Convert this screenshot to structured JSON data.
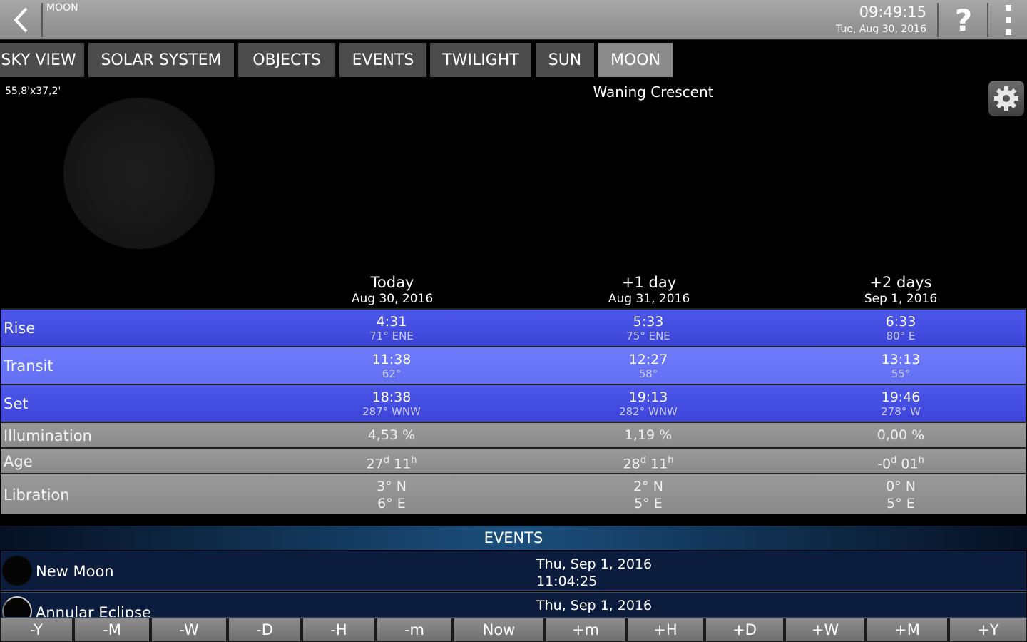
{
  "header": {
    "title": "MOON",
    "time": "09:49:15",
    "date": "Tue, Aug 30, 2016",
    "back_icon": "chevron-left-icon",
    "help_label": "?",
    "menu_icon": "overflow-menu-icon"
  },
  "tabs": [
    {
      "label": "SKY VIEW",
      "active": false
    },
    {
      "label": "SOLAR SYSTEM",
      "active": false
    },
    {
      "label": "OBJECTS",
      "active": false
    },
    {
      "label": "EVENTS",
      "active": false
    },
    {
      "label": "TWILIGHT",
      "active": false
    },
    {
      "label": "SUN",
      "active": false
    },
    {
      "label": "MOON",
      "active": true
    }
  ],
  "moon": {
    "angular_size": "55,8'x37,2'",
    "phase": "Waning Crescent",
    "settings_icon": "gear-icon"
  },
  "columns": [
    {
      "title": "Today",
      "date": "Aug 30, 2016"
    },
    {
      "title": "+1 day",
      "date": "Aug 31, 2016"
    },
    {
      "title": "+2 days",
      "date": "Sep 1, 2016"
    }
  ],
  "rows": {
    "rise": {
      "label": "Rise",
      "cells": [
        {
          "time": "4:31",
          "detail": "71° ENE"
        },
        {
          "time": "5:33",
          "detail": "75° ENE"
        },
        {
          "time": "6:33",
          "detail": "80° E"
        }
      ]
    },
    "transit": {
      "label": "Transit",
      "cells": [
        {
          "time": "11:38",
          "detail": "62°"
        },
        {
          "time": "12:27",
          "detail": "58°"
        },
        {
          "time": "13:13",
          "detail": "55°"
        }
      ]
    },
    "set": {
      "label": "Set",
      "cells": [
        {
          "time": "18:38",
          "detail": "287° WNW"
        },
        {
          "time": "19:13",
          "detail": "282° WNW"
        },
        {
          "time": "19:46",
          "detail": "278° W"
        }
      ]
    },
    "illumination": {
      "label": "Illumination",
      "cells": [
        "4,53 %",
        "1,19 %",
        "0,00 %"
      ]
    },
    "age": {
      "label": "Age",
      "cells": [
        {
          "days": "27",
          "hours": "11"
        },
        {
          "days": "28",
          "hours": "11"
        },
        {
          "days": "-0",
          "hours": "01"
        }
      ],
      "day_unit": "d",
      "hour_unit": "h"
    },
    "libration": {
      "label": "Libration",
      "cells": [
        {
          "lat": "3° N",
          "lon": "6° E"
        },
        {
          "lat": "2° N",
          "lon": "5° E"
        },
        {
          "lat": "0° N",
          "lon": "5° E"
        }
      ]
    }
  },
  "events": {
    "header": "EVENTS",
    "items": [
      {
        "name": "New Moon",
        "date": "Thu, Sep 1, 2016",
        "time": "11:04:25",
        "icon": "new-moon-icon"
      },
      {
        "name": "Annular Eclipse",
        "date": "Thu, Sep 1, 2016",
        "time": "",
        "icon": "eclipse-icon"
      }
    ]
  },
  "time_controls": [
    "-Y",
    "-M",
    "-W",
    "-D",
    "-H",
    "-m",
    "Now",
    "+m",
    "+H",
    "+D",
    "+W",
    "+M",
    "+Y"
  ]
}
